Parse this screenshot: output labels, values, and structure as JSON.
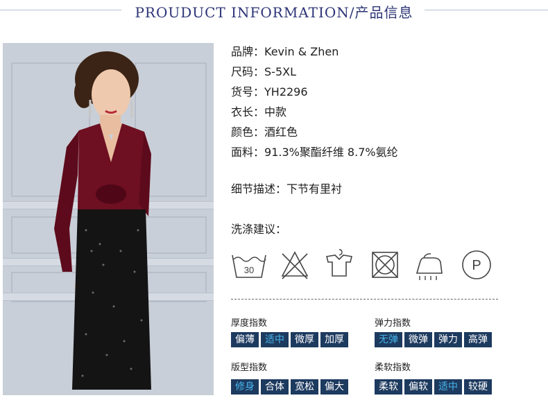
{
  "header": {
    "title": "PROUDUCT INFORMATION/产品信息"
  },
  "photo": {
    "alt": "model in wine-red velvet top and black sequin skirt"
  },
  "info": [
    {
      "label": "品牌：",
      "value": "Kevin & Zhen"
    },
    {
      "label": "尺码：",
      "value": "S-5XL"
    },
    {
      "label": "货号：",
      "value": "YH2296"
    },
    {
      "label": "衣长：",
      "value": "中款"
    },
    {
      "label": "颜色：",
      "value": "酒红色"
    },
    {
      "label": "面料：",
      "value": "91.3%聚酯纤维 8.7%氨纶"
    }
  ],
  "detail": {
    "label": "细节描述：",
    "value": "下节有里衬"
  },
  "wash": {
    "title": "洗涤建议：",
    "temp": "30",
    "dryclean": "P"
  },
  "care_icons": [
    "wash-30-icon",
    "no-bleach-icon",
    "hang-dry-icon",
    "no-tumble-dry-icon",
    "iron-icon",
    "dry-clean-p-icon"
  ],
  "indices": {
    "thickness": {
      "title": "厚度指数",
      "options": [
        "偏薄",
        "适中",
        "微厚",
        "加厚"
      ],
      "selected": 1
    },
    "elasticity": {
      "title": "弹力指数",
      "options": [
        "无弹",
        "微弹",
        "弹力",
        "高弹"
      ],
      "selected": 0
    },
    "fit": {
      "title": "版型指数",
      "options": [
        "修身",
        "合体",
        "宽松",
        "偏大"
      ],
      "selected": 0
    },
    "softness": {
      "title": "柔软指数",
      "options": [
        "柔软",
        "偏软",
        "适中",
        "较硬"
      ],
      "selected": 2
    }
  },
  "colors": {
    "chip_bg": "#1d3a5f",
    "chip_text": "#ffffff",
    "chip_active_text": "#47b4ea",
    "title_color": "#2c3476",
    "dress_top": "#6e0f22",
    "dress_skirt": "#141414"
  }
}
